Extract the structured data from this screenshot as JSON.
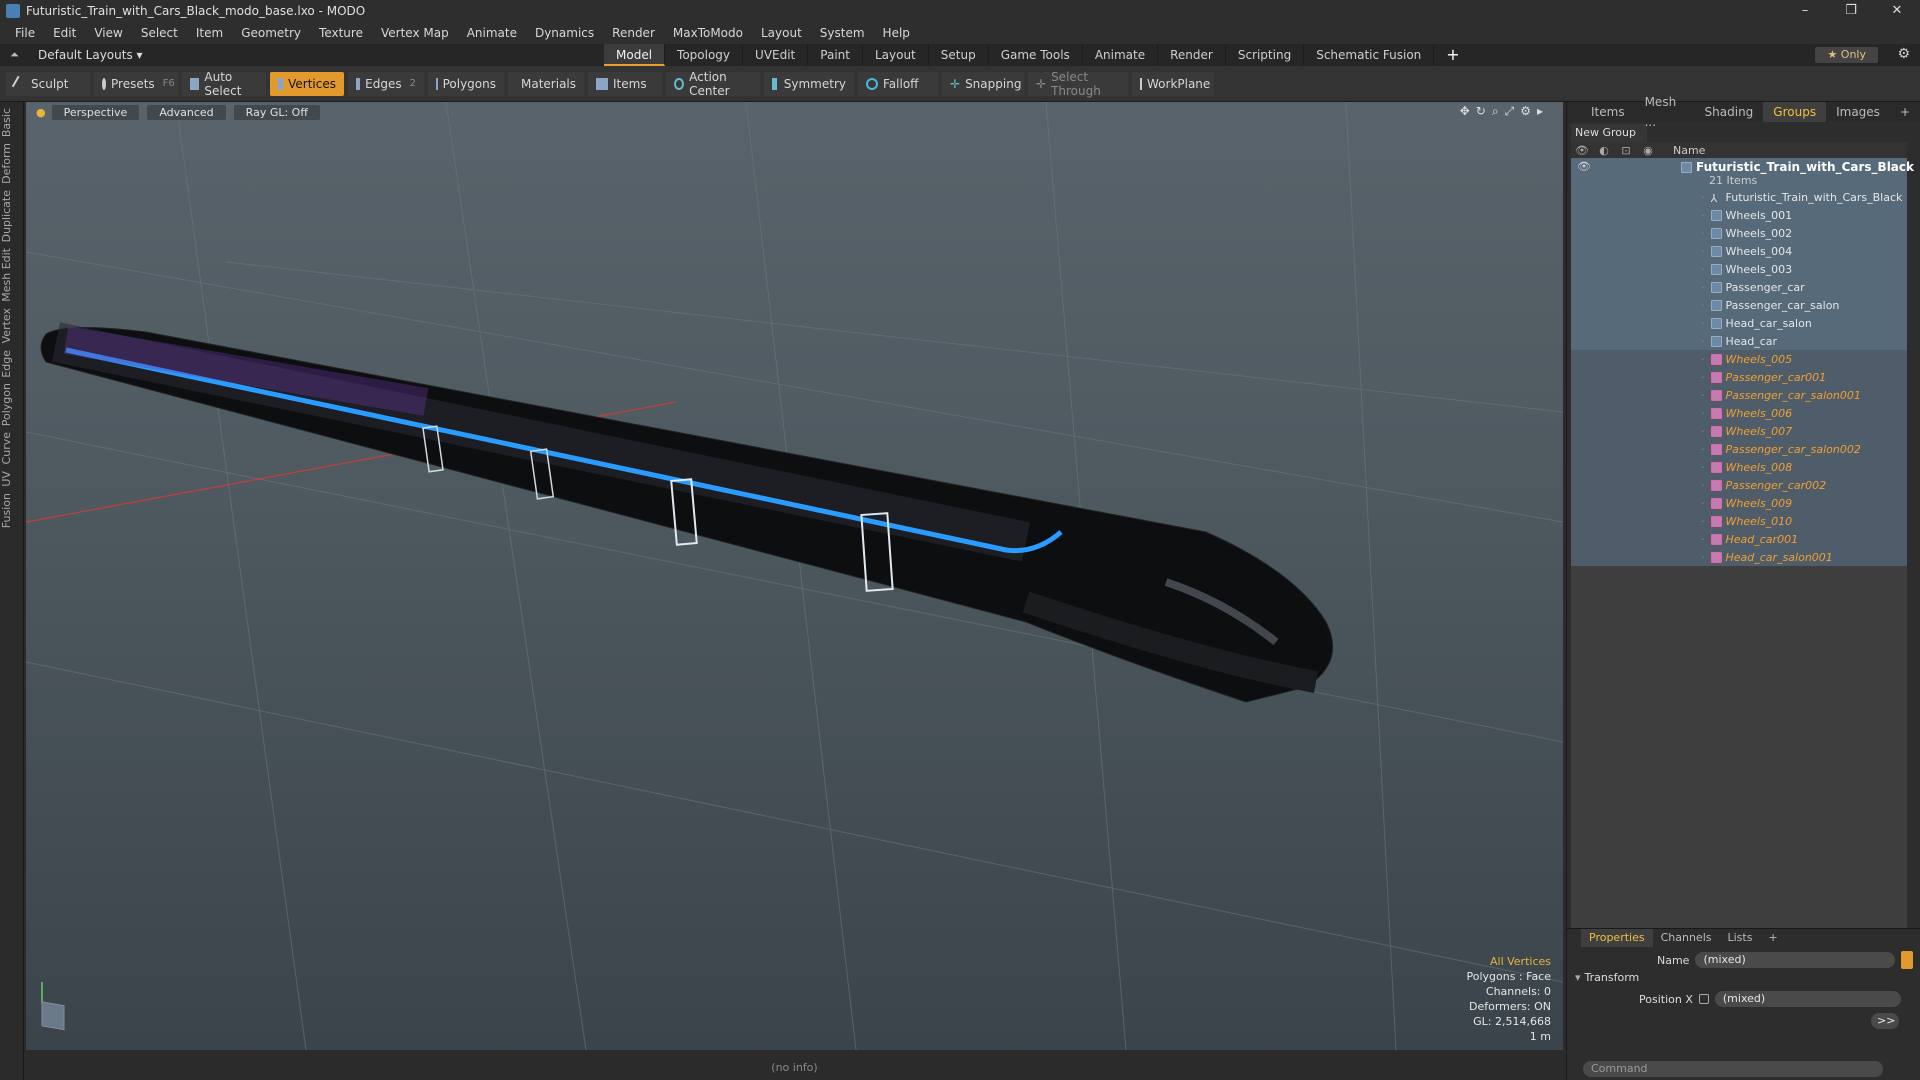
{
  "window": {
    "title": "Futuristic_Train_with_Cars_Black_modo_base.lxo - MODO",
    "buttons": [
      "–",
      "❐",
      "✕"
    ]
  },
  "menu": [
    "File",
    "Edit",
    "View",
    "Select",
    "Item",
    "Geometry",
    "Texture",
    "Vertex Map",
    "Animate",
    "Dynamics",
    "Render",
    "MaxToModo",
    "Layout",
    "System",
    "Help"
  ],
  "layoutbar": {
    "default_layouts": "Default Layouts ▾",
    "tabs": [
      "Model",
      "Topology",
      "UVEdit",
      "Paint",
      "Layout",
      "Setup",
      "Game Tools",
      "Animate",
      "Render",
      "Scripting",
      "Schematic Fusion"
    ],
    "active_tab": "Model",
    "plus": "+",
    "only": "★ Only"
  },
  "toolbar": {
    "sculpt": "Sculpt",
    "presets": "Presets",
    "presets_key": "F6",
    "auto_select": "Auto Select",
    "vertices": "Vertices",
    "edges": "Edges",
    "edges_count": "2",
    "polygons": "Polygons",
    "materials": "Materials",
    "items": "Items",
    "action_center": "Action Center",
    "symmetry": "Symmetry",
    "falloff": "Falloff",
    "snapping": "Snapping",
    "select_through": "Select Through",
    "workplane": "WorkPlane"
  },
  "sidebar_tabs": [
    "Basic",
    "Deform",
    "Duplicate",
    "Mesh Edit",
    "Vertex",
    "Edge",
    "Polygon",
    "Curve",
    "UV",
    "Fusion"
  ],
  "viewport": {
    "perspective": "Perspective",
    "advanced": "Advanced",
    "raygl": "Ray GL: Off",
    "info": {
      "mode": "All Vertices",
      "polygons": "Polygons : Face",
      "channels": "Channels: 0",
      "deformers": "Deformers: ON",
      "gl": "GL: 2,514,668",
      "scale": "1 m"
    }
  },
  "status": "(no info)",
  "right_panel": {
    "tabs": [
      "Items",
      "Mesh ...",
      "Shading",
      "Groups",
      "Images",
      "+"
    ],
    "active_tab": "Groups",
    "new_group": "New Group",
    "name_header": "Name",
    "group": "Futuristic_Train_with_Cars_Black",
    "group_count": "21 Items",
    "items": [
      {
        "label": "Futuristic_Train_with_Cars_Black",
        "type": "locator",
        "highlight": false
      },
      {
        "label": "Wheels_001",
        "type": "mesh",
        "highlight": false
      },
      {
        "label": "Wheels_002",
        "type": "mesh",
        "highlight": false
      },
      {
        "label": "Wheels_004",
        "type": "mesh",
        "highlight": false
      },
      {
        "label": "Wheels_003",
        "type": "mesh",
        "highlight": false
      },
      {
        "label": "Passenger_car",
        "type": "mesh",
        "highlight": false
      },
      {
        "label": "Passenger_car_salon",
        "type": "mesh",
        "highlight": false
      },
      {
        "label": "Head_car_salon",
        "type": "mesh",
        "highlight": false
      },
      {
        "label": "Head_car",
        "type": "mesh",
        "highlight": false
      },
      {
        "label": "Wheels_005",
        "type": "mesh",
        "highlight": true
      },
      {
        "label": "Passenger_car001",
        "type": "mesh",
        "highlight": true
      },
      {
        "label": "Passenger_car_salon001",
        "type": "mesh",
        "highlight": true
      },
      {
        "label": "Wheels_006",
        "type": "mesh",
        "highlight": true
      },
      {
        "label": "Wheels_007",
        "type": "mesh",
        "highlight": true
      },
      {
        "label": "Passenger_car_salon002",
        "type": "mesh",
        "highlight": true
      },
      {
        "label": "Wheels_008",
        "type": "mesh",
        "highlight": true
      },
      {
        "label": "Passenger_car002",
        "type": "mesh",
        "highlight": true
      },
      {
        "label": "Wheels_009",
        "type": "mesh",
        "highlight": true
      },
      {
        "label": "Wheels_010",
        "type": "mesh",
        "highlight": true
      },
      {
        "label": "Head_car001",
        "type": "mesh",
        "highlight": true
      },
      {
        "label": "Head_car_salon001",
        "type": "mesh",
        "highlight": true
      }
    ]
  },
  "properties": {
    "tabs": [
      "Properties",
      "Channels",
      "Lists",
      "+"
    ],
    "active_tab": "Properties",
    "name_label": "Name",
    "name_value": "(mixed)",
    "transform": "Transform",
    "position_x_label": "Position X",
    "position_x_value": "(mixed)",
    "more": ">>",
    "command_placeholder": "Command"
  },
  "colors": {
    "accent": "#e39a2c",
    "highlight_text": "#f0a030",
    "train_stripe": "#2a9bff"
  }
}
